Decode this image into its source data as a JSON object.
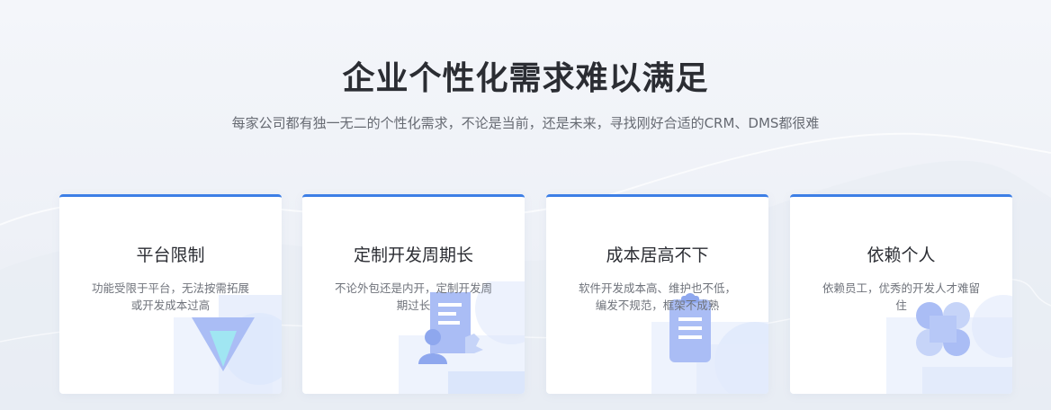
{
  "section": {
    "title": "企业个性化需求难以满足",
    "subtitle": "每家公司都有独一无二的个性化需求，不论是当前，还是未来，寻找刚好合适的CRM、DMS都很难"
  },
  "cards": [
    {
      "title": "平台限制",
      "description": "功能受限于平台，无法按需拓展或开发成本过高",
      "icon": "funnel-triangle-icon"
    },
    {
      "title": "定制开发周期长",
      "description": "不论外包还是内开，定制开发周期过长",
      "icon": "certificate-user-icon"
    },
    {
      "title": "成本居高不下",
      "description": "软件开发成本高、维护也不低，编发不规范，框架不成熟",
      "icon": "clipboard-icon"
    },
    {
      "title": "依赖个人",
      "description": "依赖员工，优秀的开发人才难留住",
      "icon": "clover-icon"
    }
  ],
  "colors": {
    "accent": "#3d7fe6",
    "icon_fill": "#aabdf5",
    "icon_light": "#dbe6fb"
  }
}
